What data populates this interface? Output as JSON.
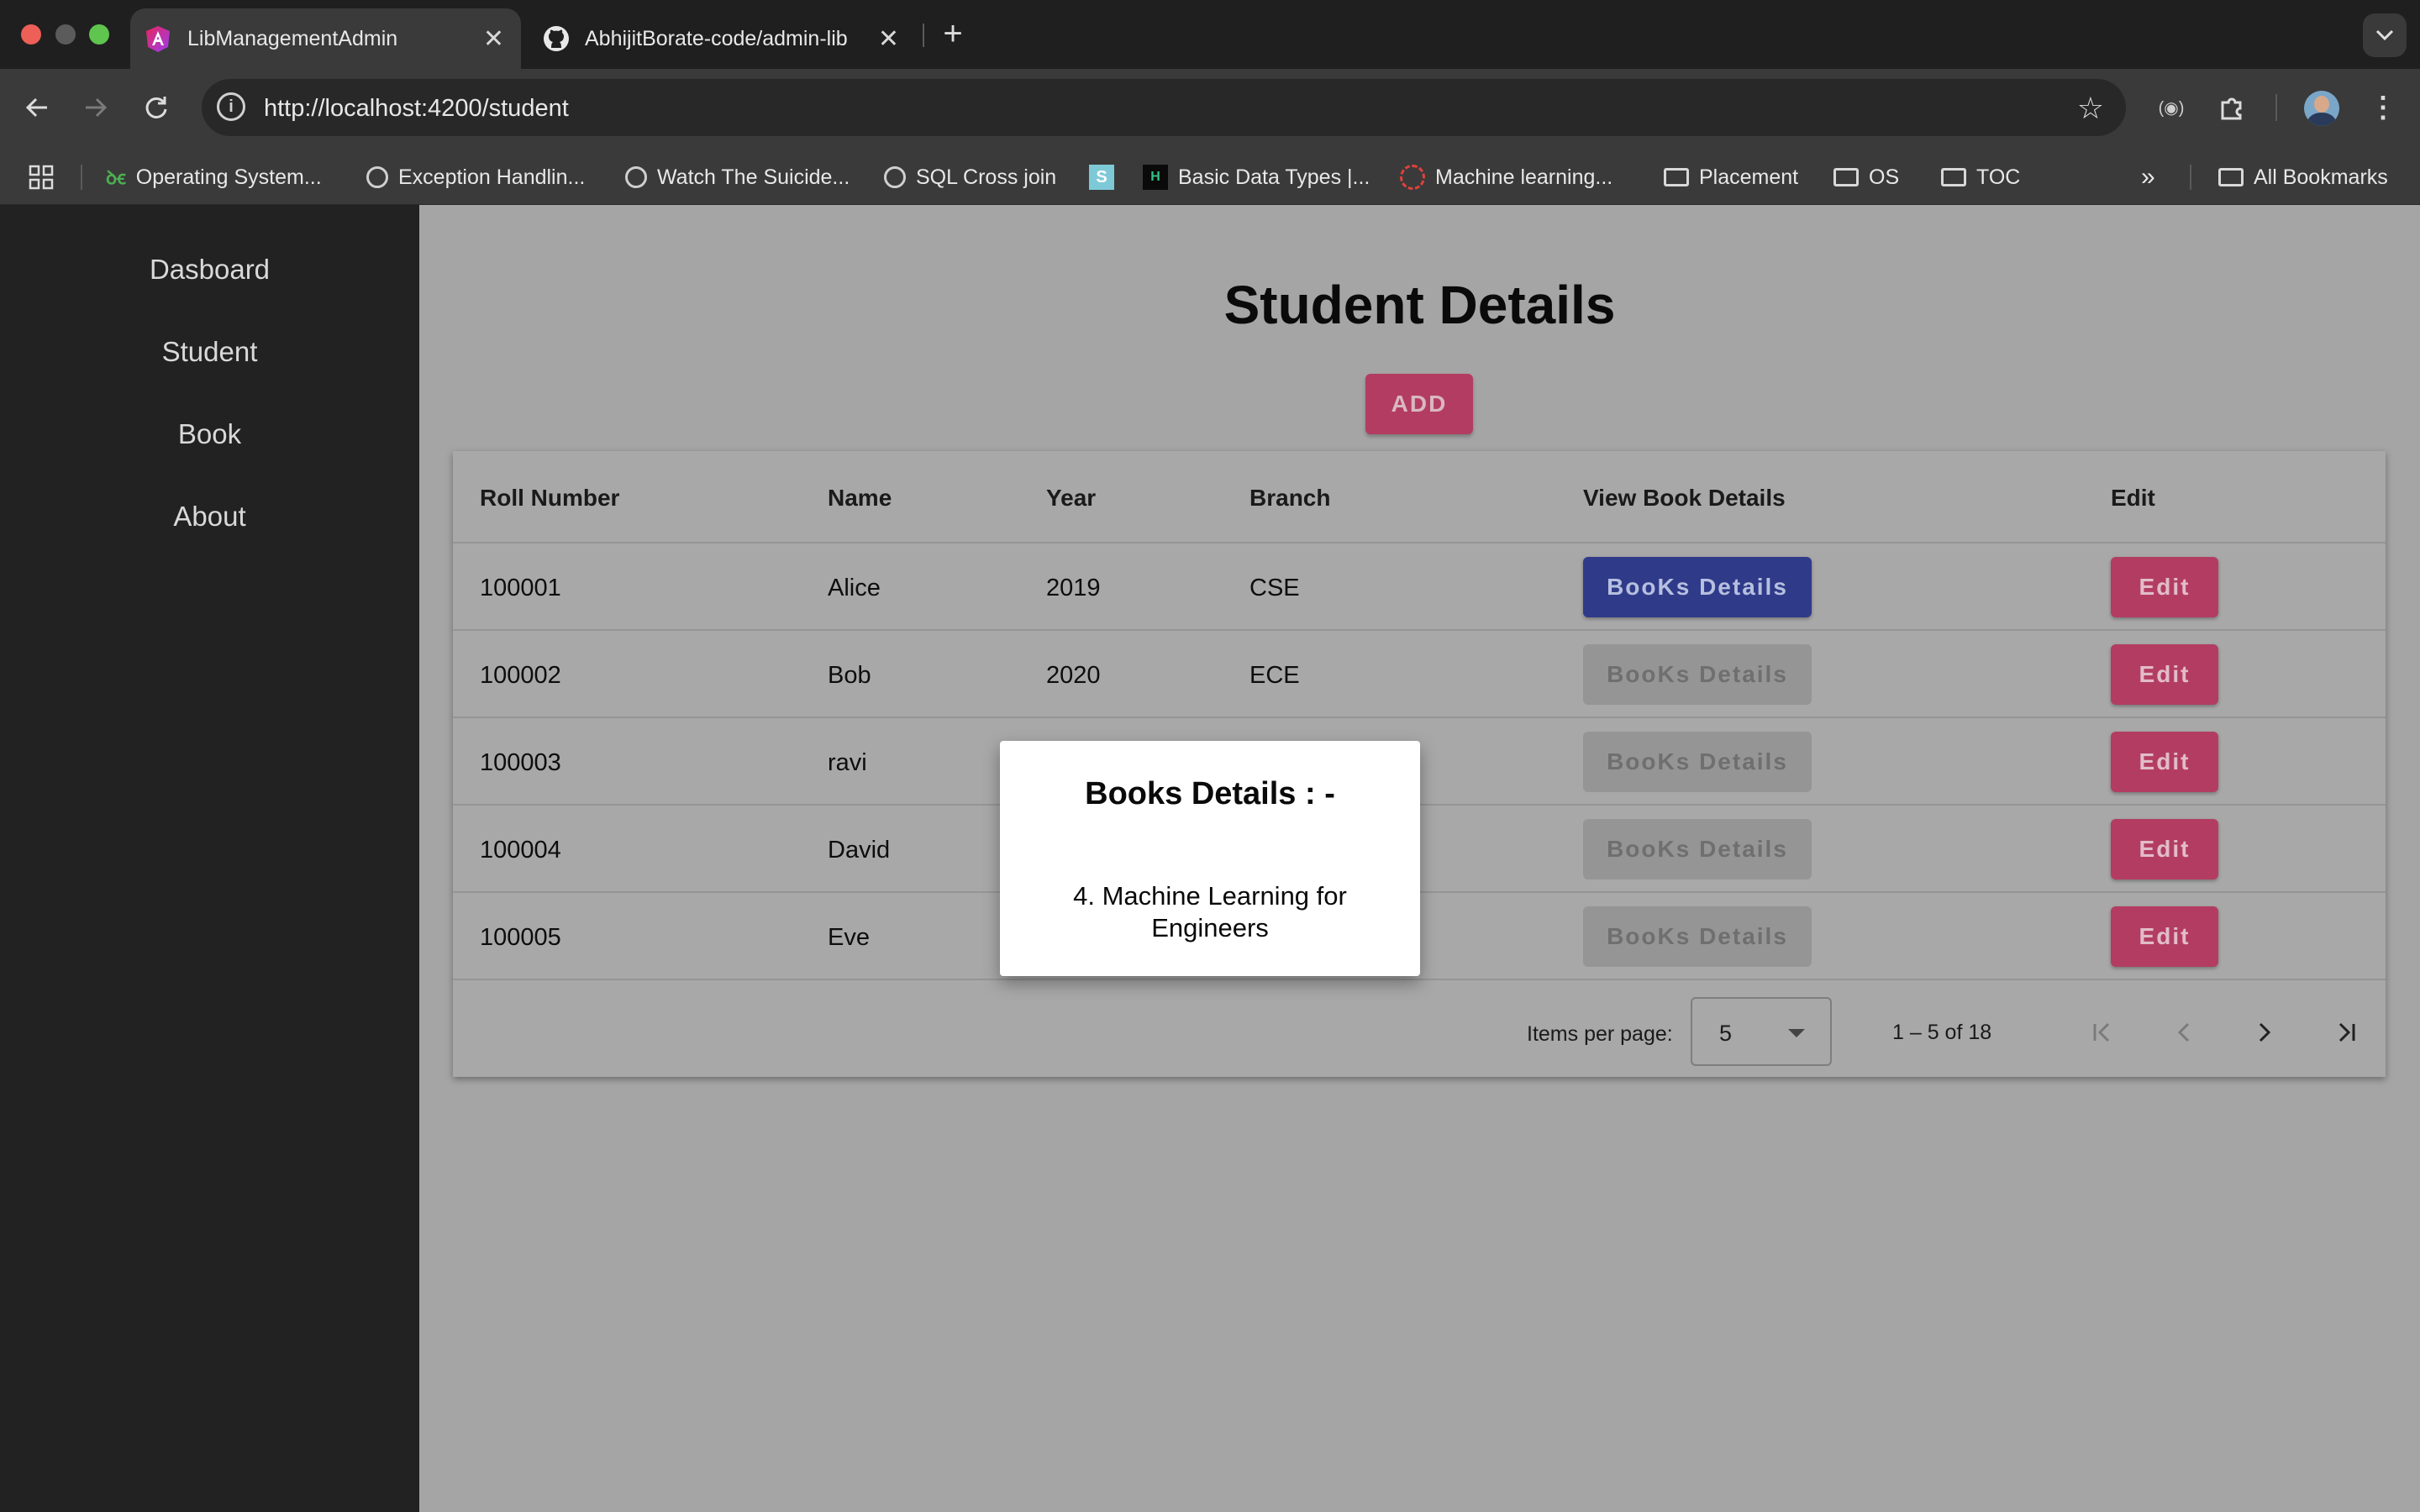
{
  "browser": {
    "tabs": [
      {
        "title": "LibManagementAdmin",
        "active": true
      },
      {
        "title": "AbhijitBorate-code/admin-lib",
        "active": false
      }
    ],
    "new_tab": "+",
    "url": "http://localhost:4200/student",
    "bookmarks": [
      {
        "label": "Operating System...",
        "icon": "gfg-icon"
      },
      {
        "label": "Exception Handlin...",
        "icon": "globe-icon"
      },
      {
        "label": "Watch The Suicide...",
        "icon": "globe-icon"
      },
      {
        "label": "SQL Cross join",
        "icon": "globe-icon"
      },
      {
        "label": "",
        "icon": "s-icon"
      },
      {
        "label": "Basic Data Types |...",
        "icon": "site-icon"
      },
      {
        "label": "Machine learning...",
        "icon": "ring-icon"
      },
      {
        "label": "Placement",
        "icon": "folder-icon"
      },
      {
        "label": "OS",
        "icon": "folder-icon"
      },
      {
        "label": "TOC",
        "icon": "folder-icon"
      }
    ],
    "more": "»",
    "all_bookmarks": "All Bookmarks"
  },
  "sidebar": {
    "items": [
      {
        "label": "Dasboard"
      },
      {
        "label": "Student"
      },
      {
        "label": "Book"
      },
      {
        "label": "About"
      }
    ]
  },
  "main": {
    "title": "Student Details",
    "add_label": "ADD"
  },
  "table": {
    "headers": [
      "Roll Number",
      "Name",
      "Year",
      "Branch",
      "View Book Details",
      "Edit"
    ],
    "rows": [
      {
        "roll": "100001",
        "name": "Alice",
        "year": "2019",
        "branch": "CSE",
        "books": "BooKs Details",
        "edit": "Edit"
      },
      {
        "roll": "100002",
        "name": "Bob",
        "year": "2020",
        "branch": "ECE",
        "books": "BooKs Details",
        "edit": "Edit"
      },
      {
        "roll": "100003",
        "name": "ravi",
        "year": "",
        "branch": "",
        "books": "BooKs Details",
        "edit": "Edit"
      },
      {
        "roll": "100004",
        "name": "David",
        "year": "",
        "branch": "",
        "books": "BooKs Details",
        "edit": "Edit"
      },
      {
        "roll": "100005",
        "name": "Eve",
        "year": "",
        "branch": "",
        "books": "BooKs Details",
        "edit": "Edit"
      }
    ]
  },
  "paginator": {
    "items_per_page_label": "Items per page:",
    "page_size": "5",
    "range": "1 – 5 of 18"
  },
  "dialog": {
    "title": "Books Details : -",
    "body": "4. Machine Learning for Engineers"
  },
  "colors": {
    "primary": "#2f3b89",
    "accent": "#b33d62",
    "sidebar": "#222222"
  }
}
